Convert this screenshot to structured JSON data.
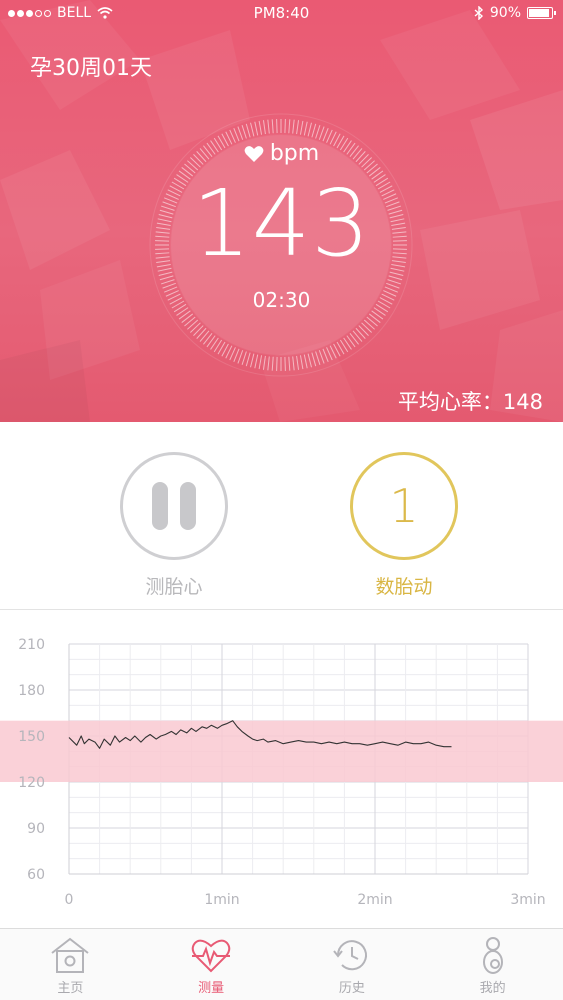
{
  "status_bar": {
    "carrier": "BELL",
    "time": "PM8:40",
    "battery": "90%",
    "battery_fraction": 0.9
  },
  "header": {
    "pregnancy_week": "孕30周01天",
    "bpm_unit": "bpm",
    "bpm_value": "143",
    "elapsed": "02:30",
    "average": "平均心率：148"
  },
  "controls": {
    "monitor_label": "测胎心",
    "kick_count": "1",
    "kick_label": "数胎动"
  },
  "chart_data": {
    "type": "line",
    "y_ticks": [
      "210",
      "180",
      "150",
      "120",
      "90",
      "60"
    ],
    "x_ticks": [
      "0",
      "1min",
      "2min",
      "3min"
    ],
    "xlim": [
      0,
      3
    ],
    "ylim": [
      60,
      210
    ],
    "normal_band": [
      120,
      160
    ],
    "grid": true,
    "series": [
      {
        "x": [
          0,
          0.05,
          0.08,
          0.1,
          0.13,
          0.17,
          0.2,
          0.23,
          0.27,
          0.3,
          0.33,
          0.37,
          0.4,
          0.43,
          0.47,
          0.5,
          0.53,
          0.57,
          0.6,
          0.63,
          0.67,
          0.7,
          0.73,
          0.77,
          0.8,
          0.83,
          0.87,
          0.9,
          0.93,
          0.97,
          1,
          1.03,
          1.07,
          1.1,
          1.13,
          1.17,
          1.2,
          1.23,
          1.27,
          1.3,
          1.35,
          1.4,
          1.45,
          1.5,
          1.55,
          1.6,
          1.65,
          1.7,
          1.75,
          1.8,
          1.85,
          1.9,
          1.95,
          2,
          2.05,
          2.1,
          2.15,
          2.2,
          2.25,
          2.3,
          2.35,
          2.4,
          2.45,
          2.5
        ],
        "y": [
          149,
          144,
          150,
          145,
          148,
          146,
          142,
          148,
          144,
          150,
          146,
          149,
          147,
          150,
          146,
          149,
          151,
          148,
          150,
          151,
          153,
          151,
          154,
          152,
          155,
          153,
          156,
          155,
          157,
          155,
          157,
          158,
          160,
          156,
          153,
          150,
          148,
          147,
          148,
          146,
          147,
          145,
          146,
          147,
          146,
          146,
          145,
          146,
          145,
          146,
          145,
          145,
          144,
          145,
          146,
          145,
          144,
          146,
          145,
          145,
          146,
          144,
          143,
          143
        ]
      }
    ]
  },
  "tabs": [
    {
      "label": "主页",
      "icon": "home-icon"
    },
    {
      "label": "测量",
      "icon": "heartbeat-icon",
      "active": true
    },
    {
      "label": "历史",
      "icon": "history-icon"
    },
    {
      "label": "我的",
      "icon": "profile-icon"
    }
  ],
  "colors": {
    "accent": "#e85a74",
    "kick": "#dbb94a",
    "band": "#f9c9d1"
  }
}
